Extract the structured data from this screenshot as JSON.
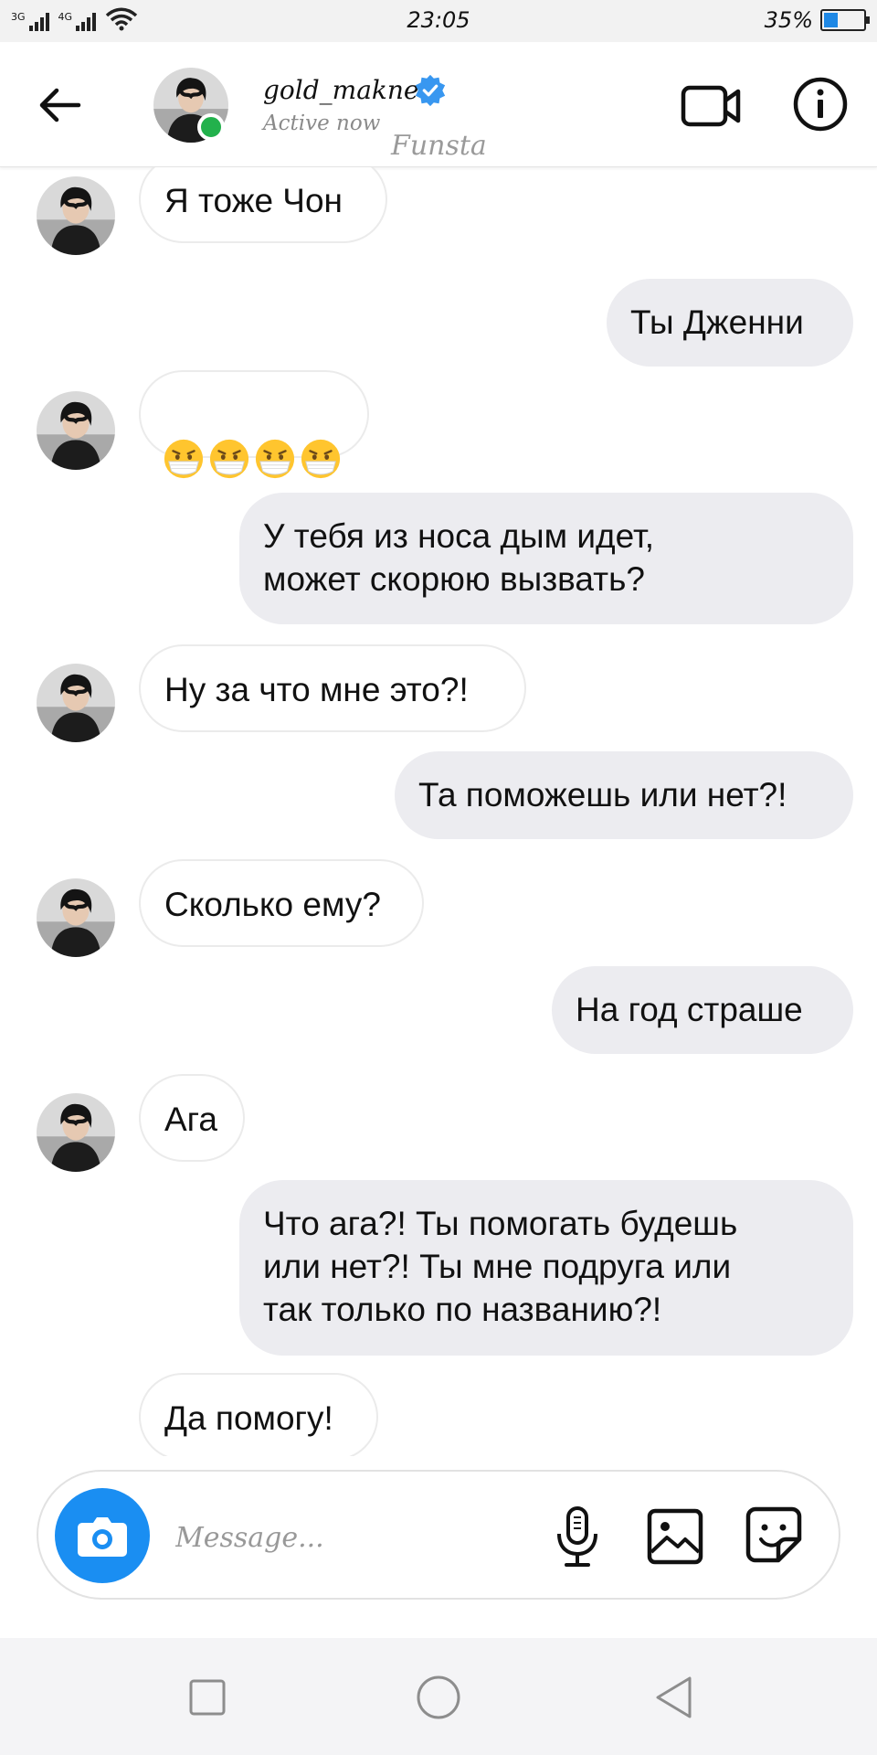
{
  "status_bar": {
    "network_1": "3G",
    "network_2": "4G",
    "time": "23:05",
    "battery": "35%",
    "battery_level": 0.35,
    "icons": [
      "signal-icon",
      "wifi-icon",
      "battery-icon"
    ]
  },
  "header": {
    "username": "gold_makne",
    "status": "Active now",
    "watermark": "Funsta",
    "icons": [
      "back-arrow-icon",
      "verified-badge-icon",
      "video-call-icon",
      "info-icon"
    ]
  },
  "messages": [
    {
      "side": "in",
      "text": "Я тоже Чон"
    },
    {
      "side": "out",
      "text": "Ты Дженни"
    },
    {
      "side": "in",
      "text": "",
      "emoji": [
        "mask-face-emoji",
        "mask-face-emoji",
        "mask-face-emoji",
        "mask-face-emoji"
      ]
    },
    {
      "side": "out",
      "text": "У тебя из носа дым идет,\nможет скорюю вызвать?"
    },
    {
      "side": "in",
      "text": "Ну за что мне это?!"
    },
    {
      "side": "out",
      "text": "Та поможешь или нет?!"
    },
    {
      "side": "in",
      "text": "Сколько ему?"
    },
    {
      "side": "out",
      "text": "На год страше"
    },
    {
      "side": "in",
      "text": "Ага"
    },
    {
      "side": "out",
      "text": "Что ага?! Ты помогать будешь\nили нет?! Ты мне подруга или\nтак только по названию?!"
    },
    {
      "side": "in",
      "text": "Да помогу!"
    }
  ],
  "composer": {
    "placeholder": "Message...",
    "icons": [
      "camera-icon",
      "microphone-icon",
      "gallery-icon",
      "sticker-icon"
    ]
  },
  "colors": {
    "accent": "#1a8ef2",
    "online": "#22b14c",
    "outgoing_bubble": "#ececf0",
    "incoming_border": "#ebebeb"
  }
}
